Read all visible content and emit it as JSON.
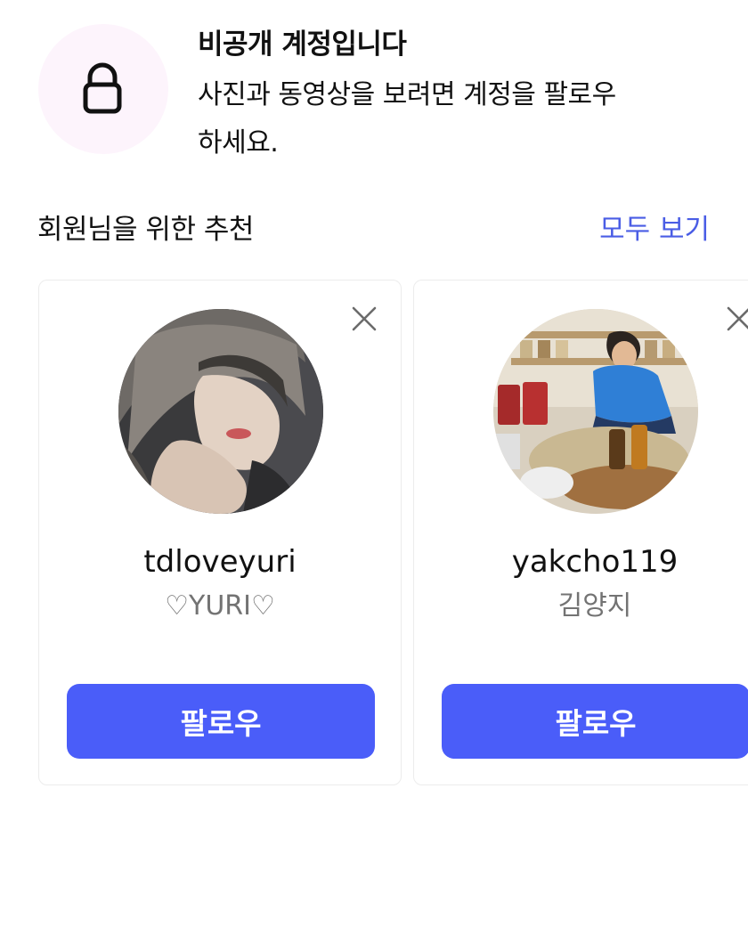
{
  "private_account": {
    "icon": "lock-icon",
    "title": "비공개 계정입니다",
    "description": "사진과 동영상을 보려면 계정을 팔로우하세요."
  },
  "recommendations": {
    "title": "회원님을 위한 추천",
    "see_all_label": "모두 보기",
    "cards": [
      {
        "username": "tdloveyuri",
        "full_name": "♡YURI♡",
        "follow_label": "팔로우",
        "close_icon": "close-icon",
        "avatar": "avatar"
      },
      {
        "username": "yakcho119",
        "full_name": "김양지",
        "follow_label": "팔로우",
        "close_icon": "close-icon",
        "avatar": "avatar"
      }
    ]
  },
  "colors": {
    "accent": "#4a5de5",
    "button": "#4a5df9",
    "lock_circle_bg": "#fdf4fc",
    "secondary_text": "#737373"
  }
}
